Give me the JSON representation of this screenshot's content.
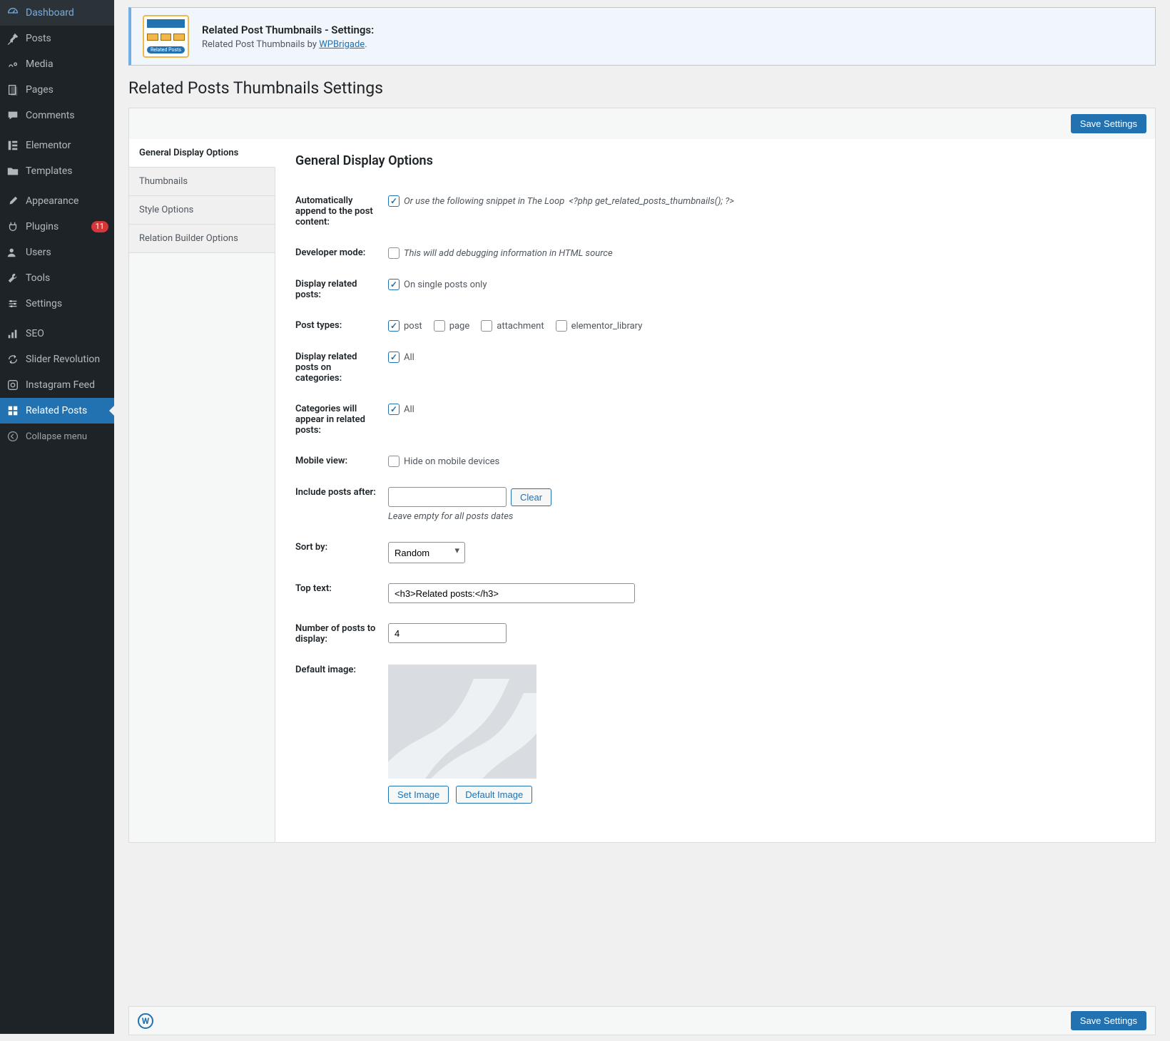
{
  "sidebar": {
    "items": [
      {
        "i": "dash",
        "label": "Dashboard"
      },
      {
        "i": "pin",
        "label": "Posts"
      },
      {
        "i": "media",
        "label": "Media"
      },
      {
        "i": "page",
        "label": "Pages"
      },
      {
        "i": "comment",
        "label": "Comments"
      },
      {
        "sep": true
      },
      {
        "i": "el",
        "label": "Elementor"
      },
      {
        "i": "folder",
        "label": "Templates"
      },
      {
        "sep": true
      },
      {
        "i": "brush",
        "label": "Appearance"
      },
      {
        "i": "plug",
        "label": "Plugins",
        "badge": "11"
      },
      {
        "i": "users",
        "label": "Users"
      },
      {
        "i": "tools",
        "label": "Tools"
      },
      {
        "i": "settings",
        "label": "Settings"
      },
      {
        "sep": true
      },
      {
        "i": "seo",
        "label": "SEO"
      },
      {
        "i": "loop",
        "label": "Slider Revolution"
      },
      {
        "i": "insta",
        "label": "Instagram Feed"
      },
      {
        "i": "grid",
        "label": "Related Posts",
        "active": true
      }
    ],
    "collapse_label": "Collapse menu"
  },
  "banner": {
    "title": "Related Post Thumbnails - Settings:",
    "subtitle_prefix": "Related Post Thumbnails by ",
    "subtitle_link": "WPBrigade",
    "subtitle_suffix": "."
  },
  "page_title": "Related Posts Thumbnails Settings",
  "save_label": "Save Settings",
  "tabs": {
    "items": [
      {
        "label": "General Display Options",
        "active": true
      },
      {
        "label": "Thumbnails"
      },
      {
        "label": "Style Options"
      },
      {
        "label": "Relation Builder Options"
      }
    ]
  },
  "panel": {
    "heading": "General Display Options",
    "rows": {
      "append": {
        "label": "Automatically append to the post content:",
        "checked": true,
        "text": "Or use the following snippet in The Loop",
        "code": "<?php get_related_posts_thumbnails(); ?>"
      },
      "dev": {
        "label": "Developer mode:",
        "checked": false,
        "text": "This will add debugging information in HTML source"
      },
      "display_rp": {
        "label": "Display related posts:",
        "checked": true,
        "text": "On single posts only"
      },
      "post_types": {
        "label": "Post types:",
        "opts": [
          {
            "v": "post",
            "checked": true
          },
          {
            "v": "page",
            "checked": false
          },
          {
            "v": "attachment",
            "checked": false
          },
          {
            "v": "elementor_library",
            "checked": false
          }
        ]
      },
      "cats": {
        "label": "Display related posts on categories:",
        "checked": true,
        "text": "All"
      },
      "cats_appear": {
        "label": "Categories will appear in related posts:",
        "checked": true,
        "text": "All"
      },
      "mobile": {
        "label": "Mobile view:",
        "checked": false,
        "text": "Hide on mobile devices"
      },
      "include_after": {
        "label": "Include posts after:",
        "value": "",
        "clear": "Clear",
        "hint": "Leave empty for all posts dates"
      },
      "sort": {
        "label": "Sort by:",
        "value": "Random"
      },
      "top_text": {
        "label": "Top text:",
        "value": "<h3>Related posts:</h3>"
      },
      "num": {
        "label": "Number of posts to display:",
        "value": "4"
      },
      "def_img": {
        "label": "Default image:",
        "set": "Set Image",
        "default": "Default Image"
      }
    }
  }
}
